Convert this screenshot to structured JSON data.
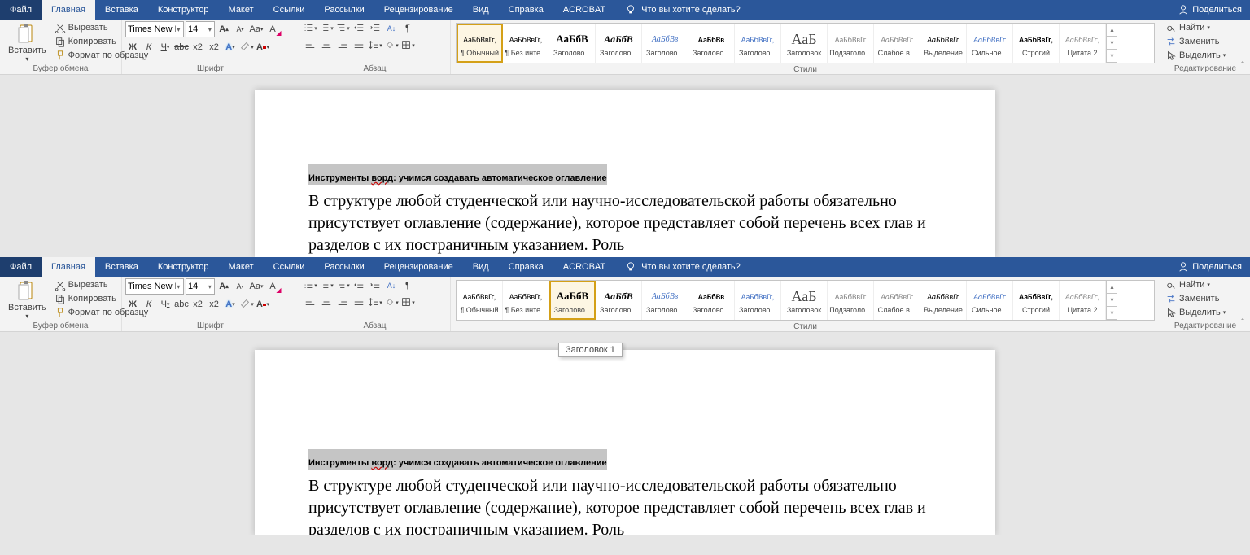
{
  "tabs": {
    "file": "Файл",
    "home": "Главная",
    "insert": "Вставка",
    "design": "Конструктор",
    "layout": "Макет",
    "references": "Ссылки",
    "mailings": "Рассылки",
    "review": "Рецензирование",
    "view": "Вид",
    "help": "Справка",
    "acrobat": "ACROBAT",
    "tellme": "Что вы хотите сделать?",
    "share": "Поделиться"
  },
  "clipboard": {
    "paste": "Вставить",
    "cut": "Вырезать",
    "copy": "Копировать",
    "format": "Формат по образцу",
    "label": "Буфер обмена"
  },
  "font": {
    "name": "Times New Roman",
    "size": "14",
    "label": "Шрифт"
  },
  "paragraph": {
    "label": "Абзац"
  },
  "styles": {
    "label": "Стили",
    "items": [
      {
        "preview": "АаБбВвГг,",
        "name": "¶ Обычный",
        "css": "font-family:Calibri"
      },
      {
        "preview": "АаБбВвГг,",
        "name": "¶ Без инте...",
        "css": "font-family:Calibri"
      },
      {
        "preview": "АаБбВ",
        "name": "Заголово...",
        "css": "font-family:Cambria;font-size:13px;font-weight:bold"
      },
      {
        "preview": "АаБбВ",
        "name": "Заголово...",
        "css": "font-family:Cambria;font-size:12px;font-weight:bold;font-style:italic"
      },
      {
        "preview": "АаБбВв",
        "name": "Заголово...",
        "css": "font-family:Cambria;font-style:italic;color:#4472c4"
      },
      {
        "preview": "АаБбВв",
        "name": "Заголово...",
        "css": "font-family:Calibri;font-weight:bold"
      },
      {
        "preview": "АаБбВвГг,",
        "name": "Заголово...",
        "css": "font-family:Calibri;color:#4472c4"
      },
      {
        "preview": "АаБ",
        "name": "Заголовок",
        "css": "font-family:Calibri Light;font-size:18px;color:#444"
      },
      {
        "preview": "АаБбВвГг",
        "name": "Подзаголо...",
        "css": "font-family:Calibri;color:#888"
      },
      {
        "preview": "АаБбВвГг",
        "name": "Слабое в...",
        "css": "font-family:Calibri;font-style:italic;color:#888"
      },
      {
        "preview": "АаБбВвГг",
        "name": "Выделение",
        "css": "font-family:Calibri;font-style:italic"
      },
      {
        "preview": "АаБбВвГг",
        "name": "Сильное...",
        "css": "font-family:Calibri;font-style:italic;color:#4472c4"
      },
      {
        "preview": "АаБбВвГг,",
        "name": "Строгий",
        "css": "font-family:Calibri;font-weight:bold"
      },
      {
        "preview": "АаБбВвГг,",
        "name": "Цитата 2",
        "css": "font-family:Calibri;font-style:italic;color:#888"
      }
    ]
  },
  "editing": {
    "find": "Найти",
    "replace": "Заменить",
    "select": "Выделить",
    "label": "Редактирование"
  },
  "doc": {
    "h_before": "Инструменты ",
    "h_word": "ворд",
    "h_after": ": учимся создавать автоматическое оглавление",
    "body": "В структуре любой студенческой или научно-исследовательской работы обязательно присутствует оглавление (содержание), которое представляет собой перечень всех глав и разделов с их постраничным указанием. Роль"
  },
  "tooltip": "Заголовок 1",
  "top_selected_style": 0,
  "bottom_selected_style": 2
}
